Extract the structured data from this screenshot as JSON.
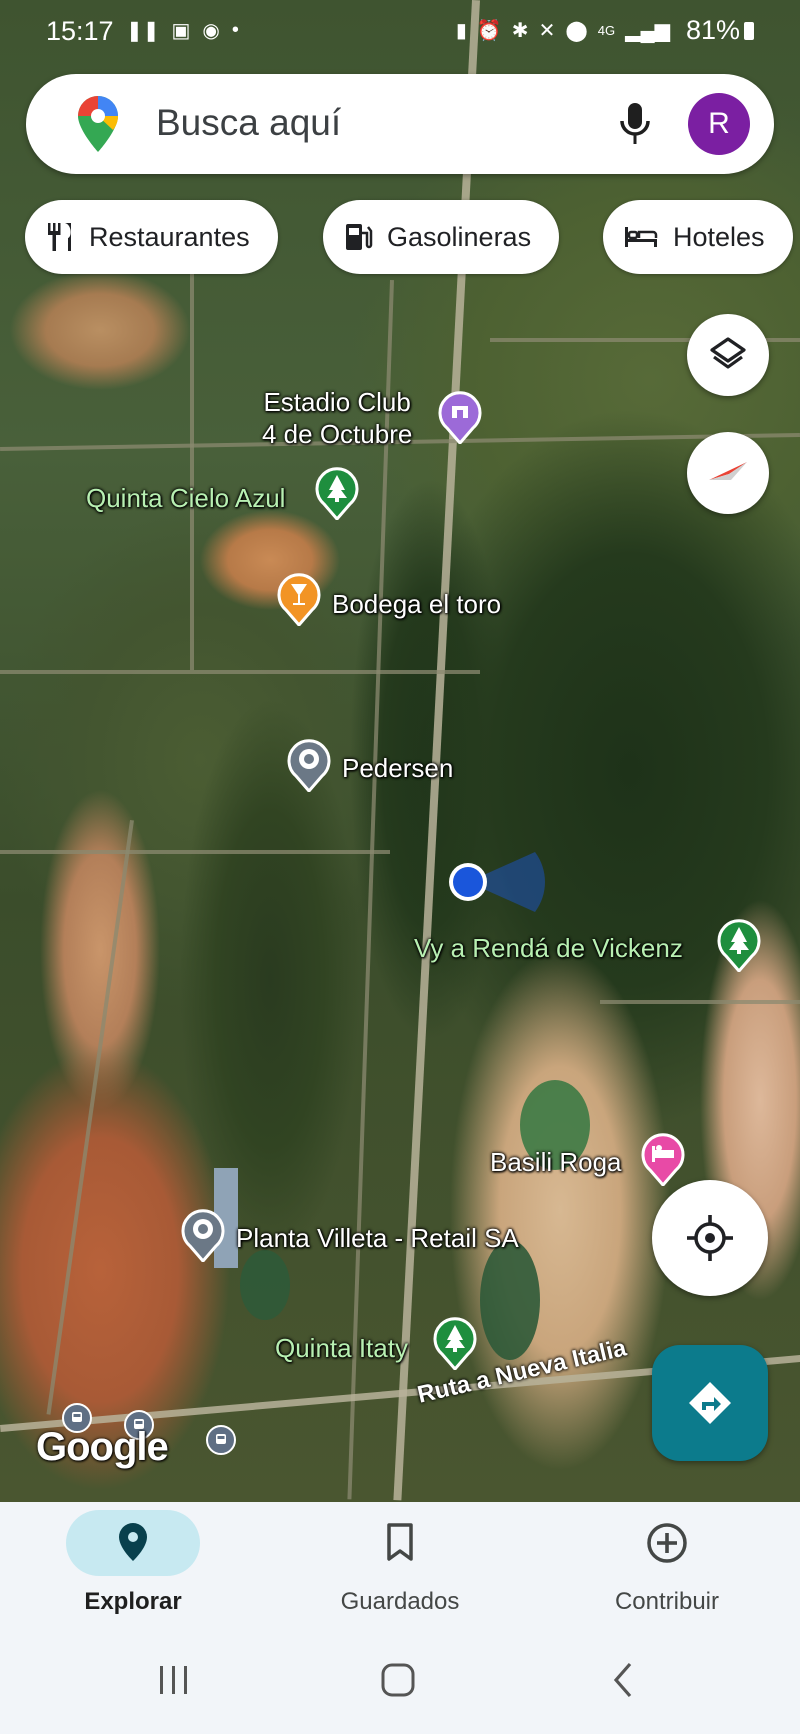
{
  "status_bar": {
    "time": "15:17",
    "battery": "81%",
    "network": "4G"
  },
  "search": {
    "placeholder": "Busca aquí",
    "avatar_initial": "R"
  },
  "chips": [
    {
      "label": "Restaurantes",
      "icon": "fork-knife-icon"
    },
    {
      "label": "Gasolineras",
      "icon": "gas-station-icon"
    },
    {
      "label": "Hoteles",
      "icon": "bed-icon"
    }
  ],
  "places": [
    {
      "name": "Estadio Club\n4 de Octubre",
      "line1": "Estadio Club",
      "line2": "4 de Octubre",
      "category": "stadium",
      "color": "#9c6ad8"
    },
    {
      "name": "Quinta Cielo Azul",
      "category": "park",
      "color": "#1e8e3e"
    },
    {
      "name": "Bodega el toro",
      "category": "bar",
      "color": "#f29425"
    },
    {
      "name": "Pedersen",
      "category": "generic",
      "color": "#6b7886"
    },
    {
      "name": "Vy a Rendá de Vickenz",
      "category": "park",
      "color": "#1e8e3e"
    },
    {
      "name": "Basili Roga",
      "category": "hotel",
      "color": "#e84aa6"
    },
    {
      "name": "Planta Villeta - Retail SA",
      "category": "generic",
      "color": "#6b7886"
    },
    {
      "name": "Quinta Itaty",
      "category": "park",
      "color": "#1e8e3e"
    }
  ],
  "road_label": "Ruta a Nueva Italia",
  "map_attribution": "Google",
  "bottom_nav": [
    {
      "label": "Explorar",
      "icon": "location-pin-icon",
      "active": true
    },
    {
      "label": "Guardados",
      "icon": "bookmark-icon",
      "active": false
    },
    {
      "label": "Contribuir",
      "icon": "add-circle-icon",
      "active": false
    }
  ],
  "colors": {
    "accent_teal": "#0c7b8c",
    "avatar_purple": "#7b1fa2",
    "location_blue": "#1a56db"
  }
}
